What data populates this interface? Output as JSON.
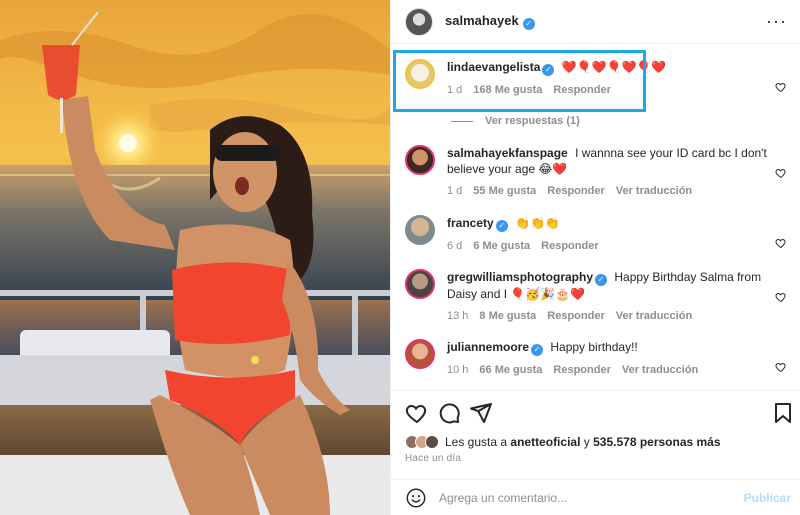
{
  "post": {
    "author": "salmahayek",
    "verified": true
  },
  "header": {
    "more_icon": "more-horizontal-icon"
  },
  "comments": [
    {
      "username": "lindaevangelista",
      "verified": true,
      "text": "❤️🎈❤️🎈❤️🎈❤️",
      "time": "1 d",
      "likes": "168 Me gusta",
      "reply": "Responder",
      "translate": "",
      "highlighted": true
    },
    {
      "username": "salmahayekfanspage",
      "verified": false,
      "text": "I wannna see your ID card bc I don't believe your age 😂❤️",
      "time": "1 d",
      "likes": "55 Me gusta",
      "reply": "Responder",
      "translate": "Ver traducción",
      "highlighted": false
    },
    {
      "username": "francety",
      "verified": true,
      "text": "👏👏👏",
      "time": "6 d",
      "likes": "6 Me gusta",
      "reply": "Responder",
      "translate": "",
      "highlighted": false
    },
    {
      "username": "gregwilliamsphotography",
      "verified": true,
      "text": "Happy Birthday Salma from Daisy and I 🎈🥳🎉🎂❤️",
      "time": "13 h",
      "likes": "8 Me gusta",
      "reply": "Responder",
      "translate": "Ver traducción",
      "highlighted": false
    },
    {
      "username": "juliannemoore",
      "verified": true,
      "text": "Happy birthday!!",
      "time": "10 h",
      "likes": "66 Me gusta",
      "reply": "Responder",
      "translate": "Ver traducción",
      "highlighted": false
    }
  ],
  "view_replies": "Ver respuestas (1)",
  "actions": {
    "like_icon": "heart-icon",
    "comment_icon": "comment-icon",
    "share_icon": "paper-plane-icon",
    "save_icon": "bookmark-icon"
  },
  "likes": {
    "prefix": "Les gusta a",
    "user": "anetteoficial",
    "middle": "y",
    "count": "535.578 personas más"
  },
  "time_ago": "Hace un día",
  "add_comment": {
    "emoji_icon": "emoji-icon",
    "placeholder": "Agrega un comentario...",
    "post_label": "Publicar"
  },
  "colors": {
    "accent": "#0095f6",
    "highlight_border": "#1ea8e6",
    "verified": "#3897f0",
    "muted": "#8e8e8e",
    "text": "#262626"
  }
}
